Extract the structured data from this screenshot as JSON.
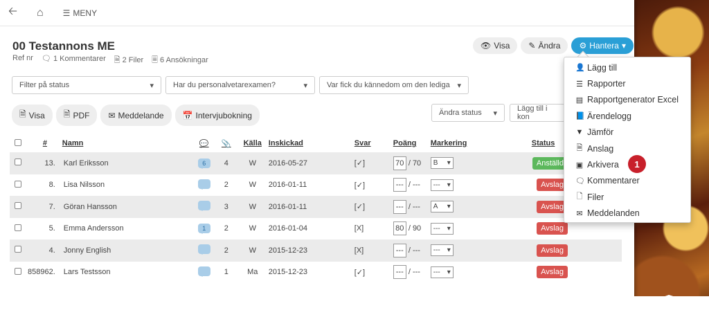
{
  "topbar": {
    "back_icon": "arrow-left-icon",
    "home_icon": "home-icon",
    "menu_label": "MENY"
  },
  "header": {
    "title": "00 Testannons ME",
    "ref": "Ref nr",
    "comments": "1 Kommentarer",
    "files": "2 Filer",
    "applications": "6 Ansökningar"
  },
  "actions": {
    "view": "Visa",
    "edit": "Ändra",
    "manage": "Hantera"
  },
  "filters": {
    "status": "Filter på status",
    "degree": "Har du personalvetarexamen?",
    "source": "Var fick du kännedom om den lediga"
  },
  "row_actions": {
    "view": "Visa",
    "pdf": "PDF",
    "message": "Meddelande",
    "interview": "Intervjubokning"
  },
  "right_selects": {
    "change_status": "Ändra status",
    "add_to": "Lägg till i kon"
  },
  "table": {
    "headers": {
      "num": "#",
      "name": "Namn",
      "source": "Källa",
      "sent": "Inskickad",
      "answer": "Svar",
      "score": "Poäng",
      "mark": "Markering",
      "status": "Status"
    },
    "rows": [
      {
        "num": "13.",
        "name": "Karl Eriksson",
        "comments": "6",
        "files": "4",
        "source": "W",
        "sent": "2016-05-27",
        "answer": "[✓]",
        "answer_ok": true,
        "score": "70",
        "max": "/ 70",
        "mark": "B",
        "status": "Anställd"
      },
      {
        "num": "8.",
        "name": "Lisa Nilsson",
        "comments": "",
        "files": "2",
        "source": "W",
        "sent": "2016-01-11",
        "answer": "[✓]",
        "answer_ok": true,
        "score": "---",
        "max": "/ ---",
        "mark": "---",
        "status": "Avslag"
      },
      {
        "num": "7.",
        "name": "Göran Hansson",
        "comments": "",
        "files": "3",
        "source": "W",
        "sent": "2016-01-11",
        "answer": "[✓]",
        "answer_ok": true,
        "score": "---",
        "max": "/ ---",
        "mark": "A",
        "status": "Avslag"
      },
      {
        "num": "5.",
        "name": "Emma Andersson",
        "comments": "1",
        "files": "2",
        "source": "W",
        "sent": "2016-01-04",
        "answer": "[X]",
        "answer_ok": false,
        "score": "80",
        "max": "/ 90",
        "mark": "---",
        "status": "Avslag"
      },
      {
        "num": "4.",
        "name": "Jonny English",
        "comments": "",
        "files": "2",
        "source": "W",
        "sent": "2015-12-23",
        "answer": "[X]",
        "answer_ok": false,
        "score": "---",
        "max": "/ ---",
        "mark": "---",
        "status": "Avslag"
      },
      {
        "num": "858962.",
        "name": "Lars Testsson",
        "comments": "",
        "files": "1",
        "source": "Ma",
        "sent": "2015-12-23",
        "answer": "[✓]",
        "answer_ok": true,
        "score": "---",
        "max": "/ ---",
        "mark": "---",
        "status": "Avslag"
      }
    ]
  },
  "dropdown": {
    "items": [
      {
        "label": "Lägg till",
        "icon": "user-plus-icon"
      },
      {
        "label": "Rapporter",
        "icon": "list-icon"
      },
      {
        "label": "Rapportgenerator Excel",
        "icon": "bar-chart-icon"
      },
      {
        "label": "Ärendelogg",
        "icon": "book-icon"
      },
      {
        "label": "Jämför",
        "icon": "filter-icon"
      },
      {
        "label": "Anslag",
        "icon": "file-text-icon"
      },
      {
        "label": "Arkivera",
        "icon": "archive-icon"
      },
      {
        "label": "Kommentarer",
        "icon": "comment-icon"
      },
      {
        "label": "Filer",
        "icon": "file-icon"
      },
      {
        "label": "Meddelanden",
        "icon": "envelope-icon"
      }
    ]
  },
  "step_badge": "1",
  "colors": {
    "primary": "#2a9fd6",
    "danger": "#d9534f",
    "success": "#5cb85c",
    "step": "#c8202b"
  }
}
